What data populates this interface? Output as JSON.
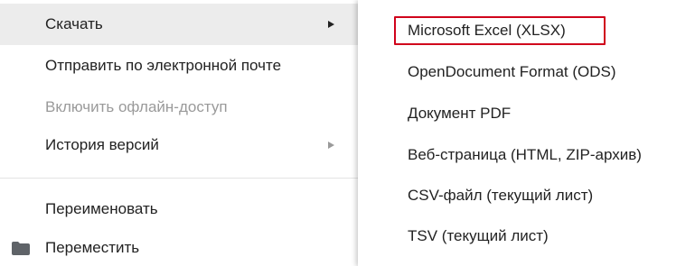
{
  "menu": {
    "items": [
      {
        "label": "Скачать",
        "state": "active",
        "has_submenu": true
      },
      {
        "label": "Отправить по электронной почте",
        "state": "normal",
        "has_submenu": false
      },
      {
        "label": "Включить офлайн-доступ",
        "state": "disabled",
        "has_submenu": false
      },
      {
        "label": "История версий",
        "state": "normal",
        "has_submenu": true
      },
      {
        "label": "Переименовать",
        "state": "normal",
        "has_submenu": false
      },
      {
        "label": "Переместить",
        "state": "normal",
        "has_submenu": false,
        "icon": "folder-icon"
      }
    ]
  },
  "submenu": {
    "items": [
      {
        "label": "Microsoft Excel (XLSX)",
        "highlighted": true
      },
      {
        "label": "OpenDocument Format (ODS)"
      },
      {
        "label": "Документ PDF"
      },
      {
        "label": "Веб-страница (HTML, ZIP-архив)"
      },
      {
        "label": "CSV-файл (текущий лист)"
      },
      {
        "label": "TSV (текущий лист)"
      }
    ]
  },
  "colors": {
    "highlight_border": "#d0021b",
    "active_row": "#ececec",
    "text": "#222222",
    "disabled_text": "#9a9a9a"
  }
}
